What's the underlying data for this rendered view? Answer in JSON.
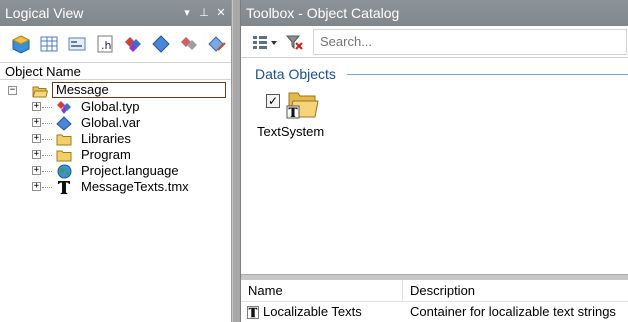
{
  "left_panel": {
    "title": "Logical View",
    "title_buttons": [
      "▾",
      "⊥",
      "✕"
    ],
    "toolbar_icons": [
      "cube-3d-icon",
      "grid-icon",
      "image-icon",
      "h-file-icon",
      "diamond-types-icon",
      "blue-diamond-icon",
      "diamond-gray-icon",
      "edit-diamond-icon"
    ],
    "column_header": "Object Name",
    "tree": {
      "root": {
        "label": "Message",
        "expander": "−",
        "icon": "open-folder-icon"
      },
      "children": [
        {
          "label": "Global.typ",
          "expander": "+",
          "icon": "types-icon"
        },
        {
          "label": "Global.var",
          "expander": "+",
          "icon": "var-diamond-icon"
        },
        {
          "label": "Libraries",
          "expander": "+",
          "icon": "folder-icon"
        },
        {
          "label": "Program",
          "expander": "+",
          "icon": "folder-icon"
        },
        {
          "label": "Project.language",
          "expander": "+",
          "icon": "globe-icon"
        },
        {
          "label": "MessageTexts.tmx",
          "expander": "+",
          "icon": "text-t-icon"
        }
      ]
    }
  },
  "right_panel": {
    "title": "Toolbox - Object Catalog",
    "search": {
      "placeholder": "Search...",
      "value": ""
    },
    "group": {
      "label": "Data Objects"
    },
    "tile": {
      "label": "TextSystem",
      "checked": true
    },
    "table": {
      "columns": [
        "Name",
        "Description"
      ],
      "rows": [
        {
          "name": "Localizable Texts",
          "description": "Container for localizable text strings"
        }
      ]
    }
  },
  "colors": {
    "titlebar": "#878e93",
    "group_header": "#1d4d8d",
    "splitter": "#a8a8a8"
  }
}
